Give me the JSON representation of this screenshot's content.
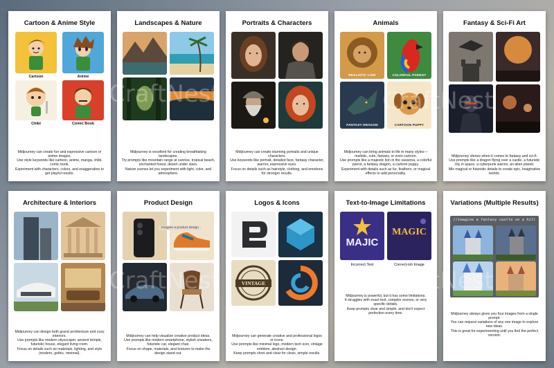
{
  "watermark": "CraftNest",
  "pages": [
    {
      "title": "Cartoon & Anime Style",
      "captions": [
        "Cartoon",
        "Anime",
        "Chibi",
        "Comic Book"
      ],
      "text": [
        "Midjourney can create fun and expressive cartoon or anime images.",
        "Use style keywords like cartoon, anime, manga, chibi, comic book.",
        "Experiment with characters, colors, and exaggeration to get playful results."
      ]
    },
    {
      "title": "Landscapes & Nature",
      "text": [
        "Midjourney is excellent for creating breathtaking landscapes.",
        "Try prompts like mountain range at sunrise, tropical beach, enchanted forest, desert under stars.",
        "Nature scenes let you experiment with light, color, and atmosphere."
      ]
    },
    {
      "title": "Portraits & Characters",
      "text": [
        "Midjourney can create stunning portraits and unique characters.",
        "Use keywords like portrait, detailed face, fantasy character, warrior, expressive eyes.",
        "Focus on details such as hairstyle, clothing, and emotions for stronger results."
      ]
    },
    {
      "title": "Animals",
      "captions": [
        "REALISTIC LION",
        "COLORFUL PARROT",
        "FANTASY DRAGON",
        "CARTOON PUPPY"
      ],
      "text": [
        "Midjourney can bring animals to life in many styles—realistic, cute, fantasy, or even cartoon.",
        "Use prompts like a majestic lion in the savanna, a colorful parrot, a fantasy dragon, a cartoon puppy.",
        "Experiment with details such as fur, feathers, or magical effects to add personality."
      ]
    },
    {
      "title": "Fantasy & Sci-Fi Art",
      "text": [
        "Midjourney shines when it comes to fantasy and sci-fi.",
        "Use prompts like a dragon flying over a castle, a futuristic city in space, a cyberpunk warrior, an alien planet.",
        "Mix magical or futuristic details to create epic, imaginative worlds."
      ]
    },
    {
      "title": "Architecture & Interiors",
      "text": [
        "Midjourney can design both grand architecture and cozy interiors.",
        "Use prompts like modern skyscraper, ancient temple, futuristic house, elegant living room.",
        "Focus on details such as materials, lighting, and style (modern, gothic, minimal)."
      ]
    },
    {
      "title": "Product Design",
      "pill": "Imagine a product design",
      "text": [
        "Midjourney can help visualize creative product ideas.",
        "Use prompts like modern smartphone, stylish sneakers, futuristic car, elegant chair.",
        "Focus on shape, materials, and textures to make the design stand out."
      ]
    },
    {
      "title": "Logos & Icons",
      "vintage": "VINTAGE",
      "text": [
        "Midjourney can generate creative and professional logos or icons.",
        "Use prompts like minimal logo, modern tech icon, vintage emblem, abstract design.",
        "Keep prompts short and clear for clean, simple results."
      ]
    },
    {
      "title": "Text-to-Image Limitations",
      "magic_left": "MAJIC",
      "magic_right": "MAGIC",
      "captions": [
        "Incorrect Text",
        "Correct-ish Image"
      ],
      "text": [
        "Midjourney is powerful, but it has some limitations.",
        "It struggles with exact text, complex scenes, or very specific details.",
        "Keep prompts clear and simple, and don't expect perfection every time."
      ]
    },
    {
      "title": "Variations (Multiple Results)",
      "prompt": "//imagine a fantasy castle on a hill",
      "text": [
        "Midjourney always gives you four images from a single prompt.",
        "You can request variations of any one image to explore new ideas.",
        "This is great for experimenting until you find the perfect version."
      ]
    }
  ]
}
